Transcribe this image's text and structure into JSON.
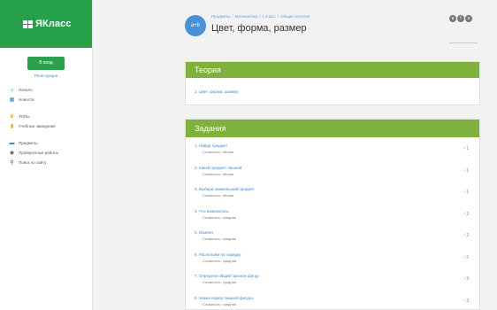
{
  "sidebar": {
    "logo": "ЯКласс",
    "login_label": "В вход",
    "register_label": "Регистрация",
    "nav_primary": [
      {
        "label": "Начало",
        "icon": "home-icon"
      },
      {
        "label": "Новости",
        "icon": "news-icon"
      }
    ],
    "nav_secondary": [
      {
        "label": "ТОПы",
        "icon": "trophy-icon"
      },
      {
        "label": "Учебные заведения",
        "icon": "school-icon"
      }
    ],
    "nav_tertiary": [
      {
        "label": "Предметы",
        "icon": "books-icon"
      },
      {
        "label": "Проверочные работы",
        "icon": "check-icon"
      },
      {
        "label": "Поиск по сайту",
        "icon": "search-icon"
      }
    ]
  },
  "header": {
    "avatar": "a+b",
    "breadcrumb": [
      "Предметы",
      "Математика",
      "1 класс",
      "Общие понятия"
    ],
    "title": "Цвет, форма, размер",
    "social": [
      "vk",
      "fb",
      "ok"
    ]
  },
  "theory": {
    "heading": "Теория",
    "items": [
      "1. Цвет, форма, размер"
    ]
  },
  "tasks": {
    "heading": "Задания",
    "items": [
      {
        "title": "1. Найди предмет",
        "difficulty": "Сложность: лёгкая",
        "score": "1"
      },
      {
        "title": "2. Какой предмет лишний",
        "difficulty": "Сложность: лёгкая",
        "score": "1"
      },
      {
        "title": "3. Выбери наименьший предмет",
        "difficulty": "Сложность: лёгкая",
        "score": "1"
      },
      {
        "title": "4. Что изменилось",
        "difficulty": "Сложность: средняя",
        "score": "2"
      },
      {
        "title": "5. Изменя",
        "difficulty": "Сложность: средняя",
        "score": "2"
      },
      {
        "title": "6. Расположи по порядку",
        "difficulty": "Сложность: средняя",
        "score": "2"
      },
      {
        "title": "7. Определи общий признак фигур",
        "difficulty": "Сложность: средняя",
        "score": "3"
      },
      {
        "title": "8. Укажи номер лишней фигуры",
        "difficulty": "Сложность: средняя",
        "score": "3"
      }
    ]
  }
}
